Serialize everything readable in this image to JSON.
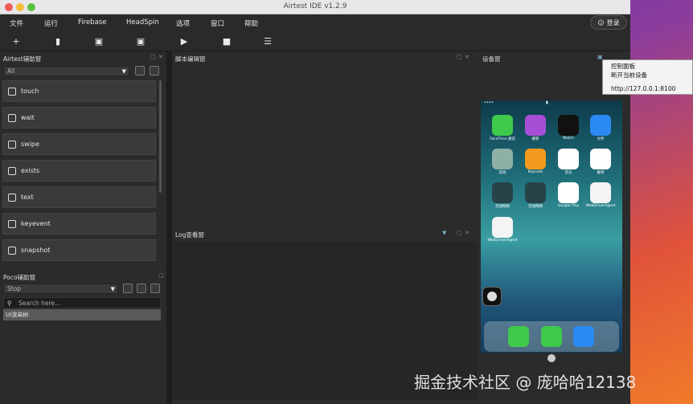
{
  "window": {
    "title": "Airtest IDE v1.2.9"
  },
  "menu": {
    "items": [
      "文件",
      "运行",
      "Firebase",
      "HeadSpin",
      "选项",
      "窗口",
      "帮助"
    ],
    "login_label": "登录"
  },
  "toolbar": {
    "icons": [
      "plus-icon",
      "folder-open-icon",
      "save-icon",
      "save-as-icon",
      "play-icon",
      "stop-icon",
      "log-icon"
    ]
  },
  "airtest_panel": {
    "title": "Airtest辅助窗",
    "filter_value": "All",
    "commands": [
      "touch",
      "wait",
      "swipe",
      "exists",
      "text",
      "keyevent",
      "snapshot"
    ]
  },
  "poco_panel": {
    "title": "Poco辅助窗",
    "mode_value": "Stop",
    "search_placeholder": "Search here...",
    "tree_root": "UI渲染树"
  },
  "script_panel": {
    "title": "脚本编辑窗"
  },
  "log_panel": {
    "title": "Log查看窗"
  },
  "device_panel": {
    "title": "设备窗"
  },
  "tooltip": {
    "line1": "控制面板",
    "line2": "断开当前设备",
    "url": "http://127.0.0.1:8100"
  },
  "phone": {
    "apps_row1": [
      "FaceTime 通话",
      "播客",
      "Watch",
      "文件"
    ],
    "apps_row2": [
      "其他",
      "Keynote",
      "音乐",
      "推特"
    ],
    "apps_row3": [
      "无线网络",
      "无线网络",
      "Google Play",
      "WebDriverAgent"
    ],
    "apps_row4": [
      "WebDriverAgent"
    ]
  },
  "watermark": "掘金技术社区 @ 庞哈哈12138"
}
